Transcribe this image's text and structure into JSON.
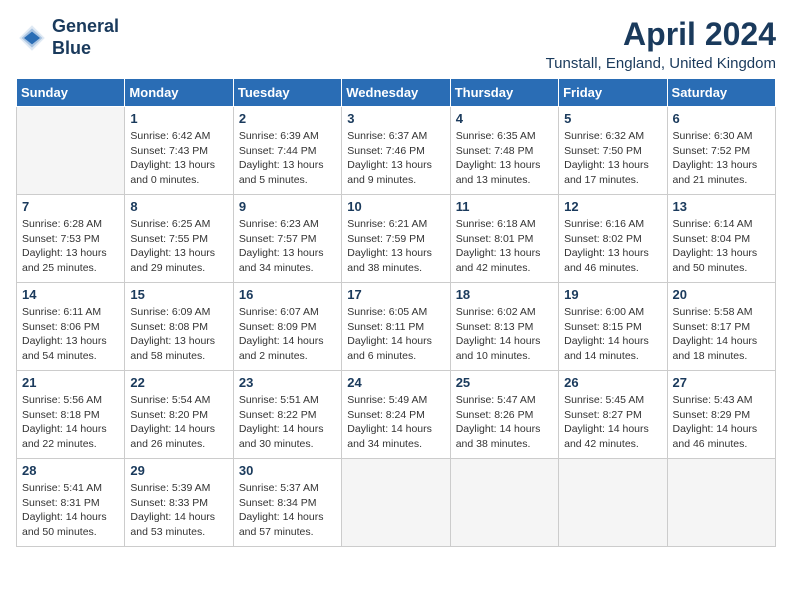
{
  "header": {
    "logo_line1": "General",
    "logo_line2": "Blue",
    "month_title": "April 2024",
    "location": "Tunstall, England, United Kingdom"
  },
  "days_of_week": [
    "Sunday",
    "Monday",
    "Tuesday",
    "Wednesday",
    "Thursday",
    "Friday",
    "Saturday"
  ],
  "weeks": [
    [
      {
        "day": "",
        "sunrise": "",
        "sunset": "",
        "daylight": ""
      },
      {
        "day": "1",
        "sunrise": "Sunrise: 6:42 AM",
        "sunset": "Sunset: 7:43 PM",
        "daylight": "Daylight: 13 hours and 0 minutes."
      },
      {
        "day": "2",
        "sunrise": "Sunrise: 6:39 AM",
        "sunset": "Sunset: 7:44 PM",
        "daylight": "Daylight: 13 hours and 5 minutes."
      },
      {
        "day": "3",
        "sunrise": "Sunrise: 6:37 AM",
        "sunset": "Sunset: 7:46 PM",
        "daylight": "Daylight: 13 hours and 9 minutes."
      },
      {
        "day": "4",
        "sunrise": "Sunrise: 6:35 AM",
        "sunset": "Sunset: 7:48 PM",
        "daylight": "Daylight: 13 hours and 13 minutes."
      },
      {
        "day": "5",
        "sunrise": "Sunrise: 6:32 AM",
        "sunset": "Sunset: 7:50 PM",
        "daylight": "Daylight: 13 hours and 17 minutes."
      },
      {
        "day": "6",
        "sunrise": "Sunrise: 6:30 AM",
        "sunset": "Sunset: 7:52 PM",
        "daylight": "Daylight: 13 hours and 21 minutes."
      }
    ],
    [
      {
        "day": "7",
        "sunrise": "Sunrise: 6:28 AM",
        "sunset": "Sunset: 7:53 PM",
        "daylight": "Daylight: 13 hours and 25 minutes."
      },
      {
        "day": "8",
        "sunrise": "Sunrise: 6:25 AM",
        "sunset": "Sunset: 7:55 PM",
        "daylight": "Daylight: 13 hours and 29 minutes."
      },
      {
        "day": "9",
        "sunrise": "Sunrise: 6:23 AM",
        "sunset": "Sunset: 7:57 PM",
        "daylight": "Daylight: 13 hours and 34 minutes."
      },
      {
        "day": "10",
        "sunrise": "Sunrise: 6:21 AM",
        "sunset": "Sunset: 7:59 PM",
        "daylight": "Daylight: 13 hours and 38 minutes."
      },
      {
        "day": "11",
        "sunrise": "Sunrise: 6:18 AM",
        "sunset": "Sunset: 8:01 PM",
        "daylight": "Daylight: 13 hours and 42 minutes."
      },
      {
        "day": "12",
        "sunrise": "Sunrise: 6:16 AM",
        "sunset": "Sunset: 8:02 PM",
        "daylight": "Daylight: 13 hours and 46 minutes."
      },
      {
        "day": "13",
        "sunrise": "Sunrise: 6:14 AM",
        "sunset": "Sunset: 8:04 PM",
        "daylight": "Daylight: 13 hours and 50 minutes."
      }
    ],
    [
      {
        "day": "14",
        "sunrise": "Sunrise: 6:11 AM",
        "sunset": "Sunset: 8:06 PM",
        "daylight": "Daylight: 13 hours and 54 minutes."
      },
      {
        "day": "15",
        "sunrise": "Sunrise: 6:09 AM",
        "sunset": "Sunset: 8:08 PM",
        "daylight": "Daylight: 13 hours and 58 minutes."
      },
      {
        "day": "16",
        "sunrise": "Sunrise: 6:07 AM",
        "sunset": "Sunset: 8:09 PM",
        "daylight": "Daylight: 14 hours and 2 minutes."
      },
      {
        "day": "17",
        "sunrise": "Sunrise: 6:05 AM",
        "sunset": "Sunset: 8:11 PM",
        "daylight": "Daylight: 14 hours and 6 minutes."
      },
      {
        "day": "18",
        "sunrise": "Sunrise: 6:02 AM",
        "sunset": "Sunset: 8:13 PM",
        "daylight": "Daylight: 14 hours and 10 minutes."
      },
      {
        "day": "19",
        "sunrise": "Sunrise: 6:00 AM",
        "sunset": "Sunset: 8:15 PM",
        "daylight": "Daylight: 14 hours and 14 minutes."
      },
      {
        "day": "20",
        "sunrise": "Sunrise: 5:58 AM",
        "sunset": "Sunset: 8:17 PM",
        "daylight": "Daylight: 14 hours and 18 minutes."
      }
    ],
    [
      {
        "day": "21",
        "sunrise": "Sunrise: 5:56 AM",
        "sunset": "Sunset: 8:18 PM",
        "daylight": "Daylight: 14 hours and 22 minutes."
      },
      {
        "day": "22",
        "sunrise": "Sunrise: 5:54 AM",
        "sunset": "Sunset: 8:20 PM",
        "daylight": "Daylight: 14 hours and 26 minutes."
      },
      {
        "day": "23",
        "sunrise": "Sunrise: 5:51 AM",
        "sunset": "Sunset: 8:22 PM",
        "daylight": "Daylight: 14 hours and 30 minutes."
      },
      {
        "day": "24",
        "sunrise": "Sunrise: 5:49 AM",
        "sunset": "Sunset: 8:24 PM",
        "daylight": "Daylight: 14 hours and 34 minutes."
      },
      {
        "day": "25",
        "sunrise": "Sunrise: 5:47 AM",
        "sunset": "Sunset: 8:26 PM",
        "daylight": "Daylight: 14 hours and 38 minutes."
      },
      {
        "day": "26",
        "sunrise": "Sunrise: 5:45 AM",
        "sunset": "Sunset: 8:27 PM",
        "daylight": "Daylight: 14 hours and 42 minutes."
      },
      {
        "day": "27",
        "sunrise": "Sunrise: 5:43 AM",
        "sunset": "Sunset: 8:29 PM",
        "daylight": "Daylight: 14 hours and 46 minutes."
      }
    ],
    [
      {
        "day": "28",
        "sunrise": "Sunrise: 5:41 AM",
        "sunset": "Sunset: 8:31 PM",
        "daylight": "Daylight: 14 hours and 50 minutes."
      },
      {
        "day": "29",
        "sunrise": "Sunrise: 5:39 AM",
        "sunset": "Sunset: 8:33 PM",
        "daylight": "Daylight: 14 hours and 53 minutes."
      },
      {
        "day": "30",
        "sunrise": "Sunrise: 5:37 AM",
        "sunset": "Sunset: 8:34 PM",
        "daylight": "Daylight: 14 hours and 57 minutes."
      },
      {
        "day": "",
        "sunrise": "",
        "sunset": "",
        "daylight": ""
      },
      {
        "day": "",
        "sunrise": "",
        "sunset": "",
        "daylight": ""
      },
      {
        "day": "",
        "sunrise": "",
        "sunset": "",
        "daylight": ""
      },
      {
        "day": "",
        "sunrise": "",
        "sunset": "",
        "daylight": ""
      }
    ]
  ]
}
